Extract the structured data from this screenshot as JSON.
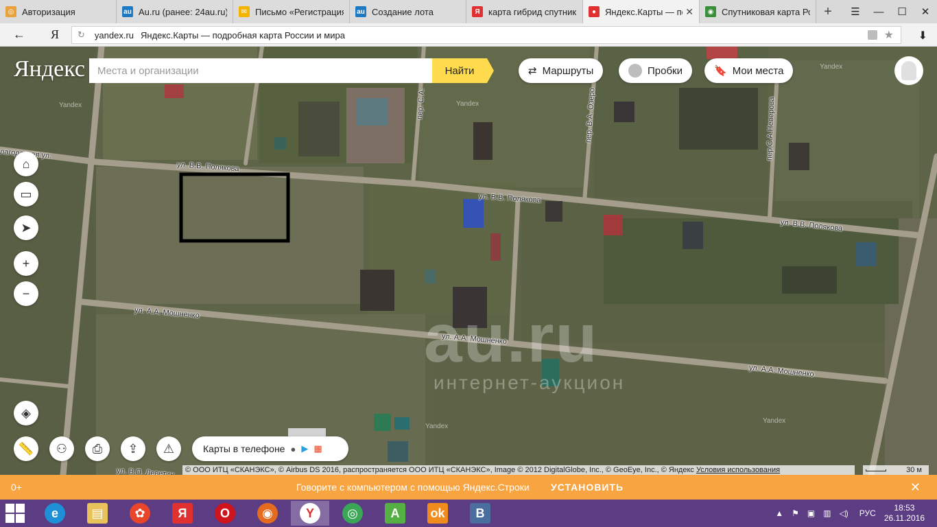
{
  "browser": {
    "tabs": [
      {
        "label": "Авторизация",
        "icon": "opera-icon",
        "color": "#e8a23b",
        "active": false
      },
      {
        "label": "Au.ru (ранее: 24au.ru)",
        "icon": "au-icon",
        "color": "#1d79c2",
        "active": false
      },
      {
        "label": "Письмо «Регистрация",
        "icon": "mail-icon",
        "color": "#f5b400",
        "active": false
      },
      {
        "label": "Создание лота",
        "icon": "au-icon",
        "color": "#1d79c2",
        "active": false
      },
      {
        "label": "карта гибрид спутник",
        "icon": "yandex-icon",
        "color": "#e03030",
        "active": false
      },
      {
        "label": "Яндекс.Карты — по",
        "icon": "map-pin-icon",
        "color": "#e03030",
        "active": true
      },
      {
        "label": "Спутниковая карта Ро",
        "icon": "globe-icon",
        "color": "#3a8f3a",
        "active": false
      }
    ],
    "tab_close": "✕",
    "new_tab": "+",
    "window_buttons": [
      "☰",
      "—",
      "☐",
      "✕"
    ],
    "back": "←",
    "logo": "Я",
    "url_domain": "yandex.ru",
    "url_title": "Яндекс.Карты — подробная карта России и мира",
    "reload": "↻",
    "star": "★",
    "download": "⬇"
  },
  "map": {
    "logo": "Яндекс",
    "search_placeholder": "Места и организации",
    "find_button": "Найти",
    "routes": "Маршруты",
    "traffic": "Пробки",
    "my_places": "Мои места",
    "phone_pill": "Карты в телефоне",
    "attribution": "© ООО ИТЦ «СКАНЭКС», © Airbus DS 2016, распространяется ООО ИТЦ «СКАНЭКС», Image © 2012 DigitalGlobe, Inc., © GeoEye, Inc., © Яндекс",
    "terms": "Условия использования",
    "scale": "30 м",
    "watermark": "au.ru",
    "watermark_sub": "интернет-аукцион",
    "yandex_wm": "Yandex",
    "streets": [
      "пер.С.А.Неверова",
      "лагодатная ул.",
      "ул. В.В. Полякова",
      "ул. В.В. Полякова",
      "ул. В.В. Полякова",
      "ул. А.А. Мошненко",
      "ул. А.А. Мошненко",
      "ул. А.А. Мошненко",
      "пер. В.А. Озеро",
      "пер. С.А.",
      "ул. В.П. Леветин"
    ]
  },
  "banner": {
    "age": "0+",
    "message": "Говорите с компьютером с помощью Яндекс.Строки",
    "install": "УСТАНОВИТЬ",
    "close": "✕"
  },
  "taskbar": {
    "lang": "РУС",
    "time": "18:53",
    "date": "26.11.2016"
  }
}
